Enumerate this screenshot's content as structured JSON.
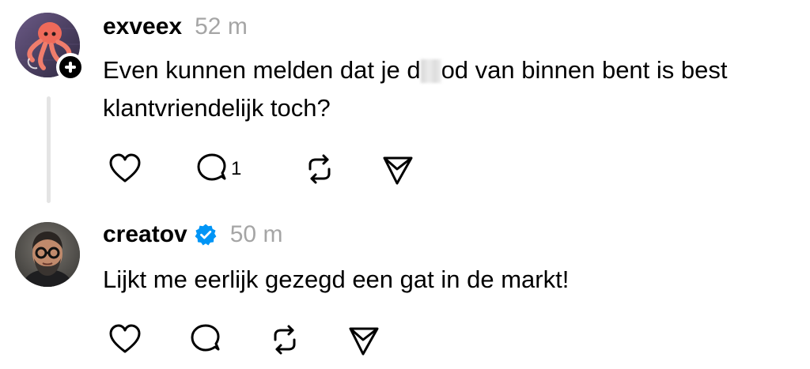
{
  "posts": [
    {
      "username": "exveex",
      "time": "52 m",
      "text_before_redaction": "Even kunnen melden dat je d",
      "text_after_redaction": "od van binnen bent is best klantvriendelijk toch?",
      "reply_count": "1",
      "has_follow_badge": true,
      "verified": false,
      "avatar": "octopus-avatar"
    },
    {
      "username": "creatov",
      "time": "50 m",
      "text": "Lijkt me eerlijk gezegd een gat in de markt!",
      "verified": true,
      "avatar": "man-with-glasses-avatar"
    }
  ],
  "colors": {
    "text": "#000000",
    "timestamp": "#a5a5a5",
    "thread_line": "#e4e4e4",
    "verified_badge": "#0095f6"
  },
  "icons": [
    "heart-icon",
    "comment-icon",
    "repost-icon",
    "share-icon",
    "verified-icon",
    "plus-icon"
  ]
}
